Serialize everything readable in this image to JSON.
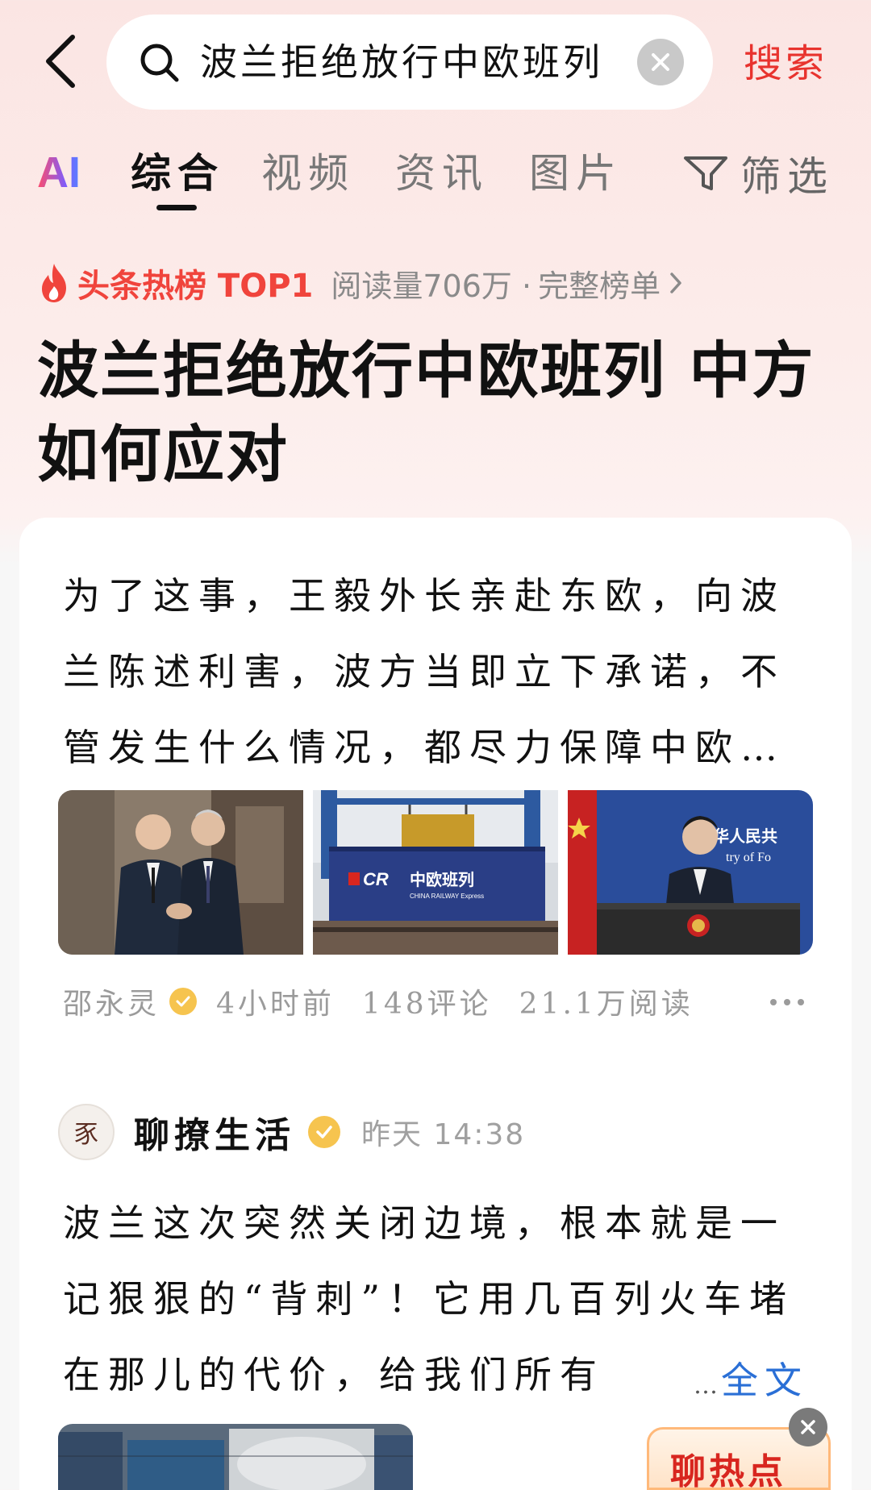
{
  "search": {
    "query": "波兰拒绝放行中欧班列",
    "submit_label": "搜索"
  },
  "tabs": {
    "ai_label": "AI",
    "items": [
      {
        "label": "综合",
        "active": true
      },
      {
        "label": "视频",
        "active": false
      },
      {
        "label": "资讯",
        "active": false
      },
      {
        "label": "图片",
        "active": false
      }
    ],
    "filter_label": "筛选"
  },
  "hot_topic": {
    "badge": "头条热榜 TOP1",
    "reads": "阅读量706万 · ",
    "link": "完整榜单",
    "headline": "波兰拒绝放行中欧班列 中方如何应对"
  },
  "post1": {
    "text": "为了这事，王毅外长亲赴东欧，向波兰陈述利害，波方当即立下承诺，不管发生什么情况，都尽力保障中欧…",
    "images": [
      {
        "name": "diplomats-handshake-photo"
      },
      {
        "name": "china-railway-express-container-photo",
        "logo_text": "CR",
        "banner_text": "中欧班列",
        "sub_text": "CHINA RAILWAY Express"
      },
      {
        "name": "press-conference-spokesperson-photo",
        "backdrop_text": "华人民共",
        "backdrop_sub": "try of Fo"
      }
    ],
    "author": "邵永灵",
    "time": "4小时前",
    "comments": "148评论",
    "reads": "21.1万阅读"
  },
  "post2": {
    "avatar_char": "豕",
    "author": "聊撩生活",
    "time": "昨天 14:38",
    "text": "波兰这次突然关闭边境，根本就是一记狠狠的“背刺”！它用几百列火车堵在那儿的代价，给我们所有",
    "fulltext_dots": "…",
    "fulltext_label": "全文"
  },
  "float_ad": {
    "label": "聊热点"
  },
  "colors": {
    "accent_red": "#e8332e",
    "link_blue": "#2a6fd6",
    "verified_gold": "#f6c44f"
  }
}
